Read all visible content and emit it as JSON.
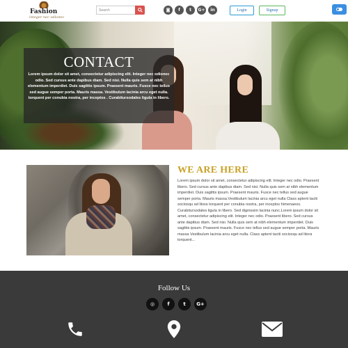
{
  "header": {
    "logo_name": "Fashion",
    "logo_tagline": "integer nec odionec",
    "search_placeholder": "Search",
    "social_icons": [
      {
        "icon": "rss-icon",
        "glyph": "◙"
      },
      {
        "icon": "facebook-icon",
        "glyph": "f"
      },
      {
        "icon": "twitter-icon",
        "glyph": "t"
      },
      {
        "icon": "google-plus-icon",
        "glyph": "G+"
      },
      {
        "icon": "linkedin-icon",
        "glyph": "in"
      }
    ],
    "login_label": "Login",
    "signup_label": "Signup"
  },
  "hero": {
    "title": "CONTACT",
    "text": "Lorem ipsum dolor sit amet, consectetur adipiscing elit. Integer nec odionec odio. Sed cursus ante dapibus diam. Sed nisi. Nulla quis sem at nibh elementum imperdiet. Duis sagittis ipsum. Praesent mauris. Fusce nec tellus sed augue semper porta. Mauris massa. Vestibulum lacinia arcu eget nulla. torquent per conubia nostra, per inceptos . Curabitursodales ligula in libero."
  },
  "about": {
    "title": "WE ARE HERE",
    "text": "Lorem ipsum dolor sit amet, consectetur adipiscing elit. Integer nec odio. Praesent libero. Sed cursus ante dapibus diam. Sed nisi. Nulla quis sem at nibh elementum imperdiet. Duis sagittis ipsum. Praesent mauris. Fusce nec tellus sed augue semper porta. Mauris massa.Vestibulum lacinia arcu eget nulla Class aptent taciti sociosqu ad litora torquent per conubia nostra, per inceptos himenaeos. Curabitursodales ligula in libero. Sed dignissim lacinia nunc.Lorem ipsum dolor sit amet, consectetur adipiscing elit. Integer nec odio. Praesent libero. Sed cursus ante dapibus diam. Sed nisi. Nulla quis sem at nibh elementum imperdiet. Duis sagittis ipsum. Praesent mauris. Fusce nec tellus sed augue semper porta. Mauris massa Vestibulum lacinia arcu eget nulla. Class aptent taciti sociosqu ad litora torquent..."
  },
  "footer": {
    "follow_title": "Follow Us",
    "social_icons": [
      {
        "icon": "instagram-icon",
        "glyph": "◎"
      },
      {
        "icon": "facebook-icon",
        "glyph": "f"
      },
      {
        "icon": "twitter-icon",
        "glyph": "t"
      },
      {
        "icon": "google-plus-icon",
        "glyph": "G+"
      }
    ],
    "contact_icons": [
      "phone-icon",
      "map-pin-icon",
      "envelope-icon"
    ]
  },
  "colors": {
    "accent_gold": "#c9a227",
    "footer_bg": "#3a3a3a",
    "search_button": "#d9534f",
    "login_border": "#2a9bd4",
    "signup_border": "#5cb85c",
    "toggle_button": "#3b8fe0"
  }
}
